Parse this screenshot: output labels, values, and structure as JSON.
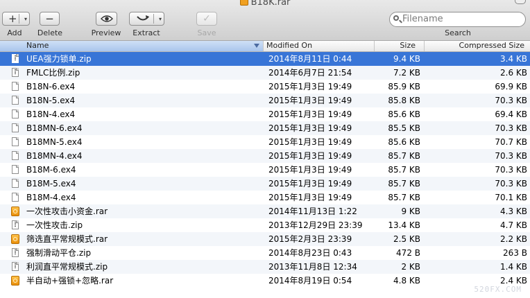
{
  "window": {
    "title": "B18K.rar"
  },
  "toolbar": {
    "add_label": "Add",
    "delete_label": "Delete",
    "preview_label": "Preview",
    "extract_label": "Extract",
    "save_label": "Save",
    "search_label": "Search",
    "search_placeholder": "Filename"
  },
  "columns": {
    "name": "Name",
    "modified": "Modified On",
    "size": "Size",
    "compressed": "Compressed Size"
  },
  "files": [
    {
      "icon": "zip-file-icon",
      "name": "UEA强力锁单.zip",
      "modified": "2014年8月11日 0:44",
      "size": "9.4 KB",
      "compressed": "3.4 KB",
      "selected": true
    },
    {
      "icon": "zip-file-icon",
      "name": "FMLC比例.zip",
      "modified": "2014年6月7日 21:54",
      "size": "7.2 KB",
      "compressed": "2.6 KB"
    },
    {
      "icon": "document-icon",
      "name": "B18N-6.ex4",
      "modified": "2015年1月3日 19:49",
      "size": "85.9 KB",
      "compressed": "69.9 KB"
    },
    {
      "icon": "document-icon",
      "name": "B18N-5.ex4",
      "modified": "2015年1月3日 19:49",
      "size": "85.8 KB",
      "compressed": "70.3 KB"
    },
    {
      "icon": "document-icon",
      "name": "B18N-4.ex4",
      "modified": "2015年1月3日 19:49",
      "size": "85.6 KB",
      "compressed": "69.4 KB"
    },
    {
      "icon": "document-icon",
      "name": "B18MN-6.ex4",
      "modified": "2015年1月3日 19:49",
      "size": "85.5 KB",
      "compressed": "70.3 KB"
    },
    {
      "icon": "document-icon",
      "name": "B18MN-5.ex4",
      "modified": "2015年1月3日 19:49",
      "size": "85.6 KB",
      "compressed": "70.7 KB"
    },
    {
      "icon": "document-icon",
      "name": "B18MN-4.ex4",
      "modified": "2015年1月3日 19:49",
      "size": "85.7 KB",
      "compressed": "70.3 KB"
    },
    {
      "icon": "document-icon",
      "name": "B18M-6.ex4",
      "modified": "2015年1月3日 19:49",
      "size": "85.7 KB",
      "compressed": "70.3 KB"
    },
    {
      "icon": "document-icon",
      "name": "B18M-5.ex4",
      "modified": "2015年1月3日 19:49",
      "size": "85.7 KB",
      "compressed": "70.3 KB"
    },
    {
      "icon": "document-icon",
      "name": "B18M-4.ex4",
      "modified": "2015年1月3日 19:49",
      "size": "85.7 KB",
      "compressed": "70.1 KB"
    },
    {
      "icon": "rar-archive-icon",
      "name": "一次性攻击小资金.rar",
      "modified": "2014年11月13日 1:22",
      "size": "9 KB",
      "compressed": "4.3 KB"
    },
    {
      "icon": "zip-file-icon",
      "name": "一次性攻击.zip",
      "modified": "2013年12月29日 23:39",
      "size": "13.4 KB",
      "compressed": "4.7 KB"
    },
    {
      "icon": "rar-archive-icon",
      "name": "筛选直平常规模式.rar",
      "modified": "2015年2月3日 23:39",
      "size": "2.5 KB",
      "compressed": "2.2 KB"
    },
    {
      "icon": "zip-file-icon",
      "name": "强制滑动平仓.zip",
      "modified": "2014年8月23日 0:43",
      "size": "472 B",
      "compressed": "263 B"
    },
    {
      "icon": "zip-file-icon",
      "name": "利润直平常规模式.zip",
      "modified": "2013年11月8日 12:34",
      "size": "2 KB",
      "compressed": "1.4 KB"
    },
    {
      "icon": "rar-archive-icon",
      "name": "半自动+强锁+忽略.rar",
      "modified": "2014年8月19日 0:54",
      "size": "4.8 KB",
      "compressed": "2.4 KB"
    }
  ],
  "watermark": "520FX.COM"
}
